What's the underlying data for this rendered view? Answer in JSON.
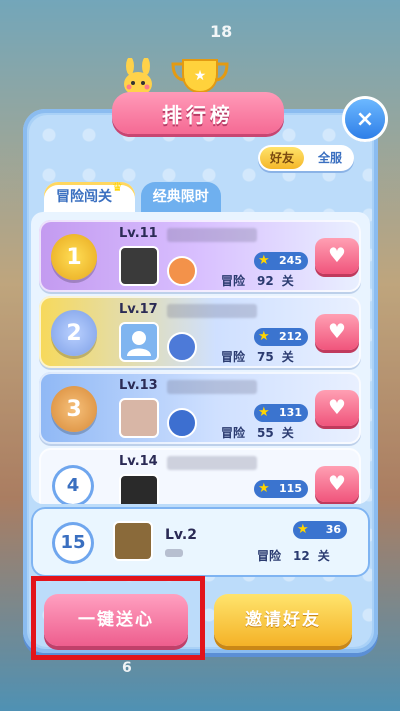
{
  "background": {
    "level_top": "18",
    "level_bottom": "6"
  },
  "header": {
    "title": "排行榜",
    "close_icon": "×"
  },
  "scope_toggle": {
    "friends": "好友",
    "global": "全服",
    "selected": "friends"
  },
  "tabs": [
    {
      "label": "冒险闯关",
      "active": true
    },
    {
      "label": "经典限时",
      "active": false
    }
  ],
  "rows": [
    {
      "rank": "1",
      "level": "Lv.11",
      "stars": "245",
      "adv_label": "冒险",
      "adv_value": "92",
      "adv_unit": "关"
    },
    {
      "rank": "2",
      "level": "Lv.17",
      "stars": "212",
      "adv_label": "冒险",
      "adv_value": "75",
      "adv_unit": "关"
    },
    {
      "rank": "3",
      "level": "Lv.13",
      "stars": "131",
      "adv_label": "冒险",
      "adv_value": "55",
      "adv_unit": "关"
    },
    {
      "rank": "4",
      "level": "Lv.14",
      "stars": "115",
      "adv_label": "",
      "adv_value": "",
      "adv_unit": ""
    }
  ],
  "self_row": {
    "rank": "15",
    "level": "Lv.2",
    "stars": "36",
    "adv_label": "冒险",
    "adv_value": "12",
    "adv_unit": "关"
  },
  "buttons": {
    "send_hearts": "一键送心",
    "invite_friends": "邀请好友"
  },
  "colors": {
    "highlight": "#e2141b",
    "gold_row": "#f7d95a",
    "silver_row": "#9fb9f5",
    "bronze_row": "#f1b265",
    "purple_row": "#c9a2f0"
  }
}
